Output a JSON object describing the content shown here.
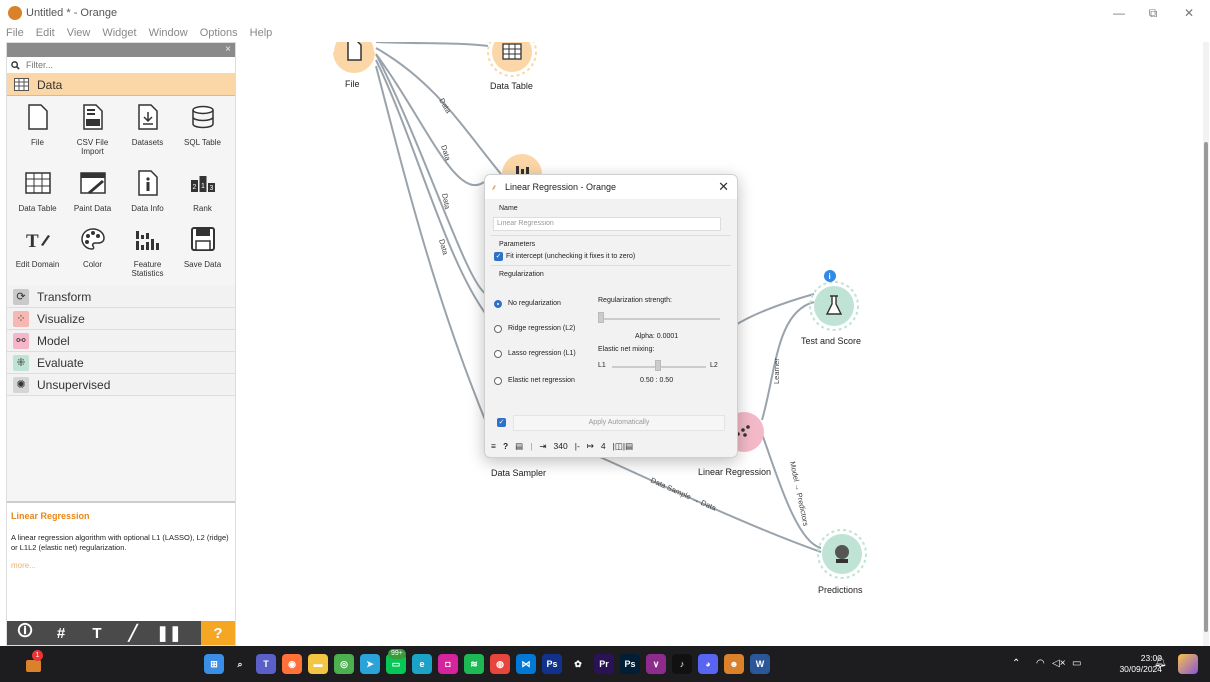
{
  "window": {
    "title": "Untitled * - Orange",
    "minimize_glyph": "—",
    "restore_glyph": "⧉",
    "close_glyph": "✕"
  },
  "menu": [
    "File",
    "Edit",
    "View",
    "Widget",
    "Window",
    "Options",
    "Help"
  ],
  "dock": {
    "close_glyph": "×",
    "filter_placeholder": "Filter...",
    "active_category": "Data",
    "widgets": [
      {
        "label": "File",
        "icon": "file-icon"
      },
      {
        "label": "CSV File Import",
        "icon": "csv-icon"
      },
      {
        "label": "Datasets",
        "icon": "datasets-icon"
      },
      {
        "label": "SQL Table",
        "icon": "database-icon"
      },
      {
        "label": "Data Table",
        "icon": "table-icon"
      },
      {
        "label": "Paint Data",
        "icon": "paint-icon"
      },
      {
        "label": "Data Info",
        "icon": "info-icon"
      },
      {
        "label": "Rank",
        "icon": "rank-icon"
      },
      {
        "label": "Edit Domain",
        "icon": "edit-domain-icon"
      },
      {
        "label": "Color",
        "icon": "palette-icon"
      },
      {
        "label": "Feature Statistics",
        "icon": "bar-chart-icon"
      },
      {
        "label": "Save Data",
        "icon": "save-icon"
      }
    ],
    "categories": [
      {
        "label": "Transform",
        "color": "#c9c9c9"
      },
      {
        "label": "Visualize",
        "color": "#f5b8b2"
      },
      {
        "label": "Model",
        "color": "#f6b6ca"
      },
      {
        "label": "Evaluate",
        "color": "#bfe3d4"
      },
      {
        "label": "Unsupervised",
        "color": "#d5d5d5"
      }
    ],
    "help": {
      "title": "Linear Regression",
      "text": "A linear regression algorithm with optional L1 (LASSO), L2 (ridge) or L1L2 (elastic net) regularization.",
      "more": "more..."
    },
    "toolbar": [
      "🛈",
      "#",
      "T",
      "╱",
      "❚❚",
      "?"
    ]
  },
  "canvas": {
    "nodes": {
      "file": "File",
      "data_table": "Data Table",
      "data_sampler": "Data Sampler",
      "linear_regression": "Linear Regression",
      "test_and_score": "Test and Score",
      "predictions": "Predictions"
    },
    "links": {
      "data1": "Data",
      "data2": "Data",
      "data3": "Data",
      "data4": "Data",
      "learner": "Learner",
      "model_predictors": "Model → Predictors",
      "sample_data": "Data Sample → Data"
    },
    "info_badge": "i"
  },
  "dialog": {
    "title": "Linear Regression - Orange",
    "close_glyph": "✕",
    "name_label": "Name",
    "name_value": "Linear Regression",
    "parameters_label": "Parameters",
    "fit_intercept": "Fit intercept (unchecking it fixes it to zero)",
    "fit_intercept_checked": true,
    "regularization_label": "Regularization",
    "options": [
      "No regularization",
      "Ridge regression (L2)",
      "Lasso regression (L1)",
      "Elastic net regression"
    ],
    "selected_option": "No regularization",
    "strength_label": "Regularization strength:",
    "alpha": "Alpha: 0.0001",
    "elastic_label": "Elastic net mixing:",
    "l1": "L1",
    "l2": "L2",
    "mix_value": "0.50 : 0.50",
    "apply_label": "Apply Automatically",
    "apply_checked": true,
    "status_in": "340",
    "status_out": "4",
    "status_sep": "|-",
    "status_end": "|◫|▤"
  },
  "taskbar": {
    "notif_badge": "1",
    "chat_badge": "99+",
    "time": "23:00",
    "date": "30/09/2024",
    "icons": [
      {
        "name": "windows-start-icon",
        "color": "#3a8ee6",
        "glyph": "⊞"
      },
      {
        "name": "search-icon",
        "color": "#1d1d1f",
        "glyph": "⌕"
      },
      {
        "name": "teams-icon",
        "color": "#5b5fc7",
        "glyph": "T"
      },
      {
        "name": "firefox-icon",
        "color": "#ff7139",
        "glyph": "◉"
      },
      {
        "name": "file-explorer-icon",
        "color": "#f4c542",
        "glyph": "▬"
      },
      {
        "name": "chat-icon",
        "color": "#4caf50",
        "glyph": "◎"
      },
      {
        "name": "telegram-icon",
        "color": "#2aa3d9",
        "glyph": "➤"
      },
      {
        "name": "line-icon",
        "color": "#06c755",
        "glyph": "▭"
      },
      {
        "name": "edge-icon",
        "color": "#1aa3c7",
        "glyph": "e"
      },
      {
        "name": "instagram-icon",
        "color": "#d6249f",
        "glyph": "◘"
      },
      {
        "name": "spotify-icon",
        "color": "#1db954",
        "glyph": "≋"
      },
      {
        "name": "chrome-icon",
        "color": "#e8453c",
        "glyph": "◍"
      },
      {
        "name": "vscode-icon",
        "color": "#0078d4",
        "glyph": "⋈"
      },
      {
        "name": "photoshop-express-icon",
        "color": "#11328c",
        "glyph": "Ps"
      },
      {
        "name": "chatgpt-icon",
        "color": "#1d1d1f",
        "glyph": "✿"
      },
      {
        "name": "premiere-icon",
        "color": "#2a1257",
        "glyph": "Pr"
      },
      {
        "name": "photoshop-icon",
        "color": "#001e36",
        "glyph": "Ps"
      },
      {
        "name": "vs-icon",
        "color": "#8e2c8e",
        "glyph": "∨"
      },
      {
        "name": "tiktok-icon",
        "color": "#111111",
        "glyph": "♪"
      },
      {
        "name": "discord-icon",
        "color": "#5865f2",
        "glyph": "◕"
      },
      {
        "name": "orange-icon",
        "color": "#d9822b",
        "glyph": "☻"
      },
      {
        "name": "word-icon",
        "color": "#2b579a",
        "glyph": "W"
      }
    ],
    "tray": [
      "⌃",
      "◠",
      "◁×",
      "▭"
    ]
  },
  "colors": {
    "accent": "#f5a623",
    "data_node": "#fbd7a7",
    "model_node": "#f3b9c8",
    "evaluate_node": "#bfe3d4",
    "check": "#2f71c7"
  }
}
